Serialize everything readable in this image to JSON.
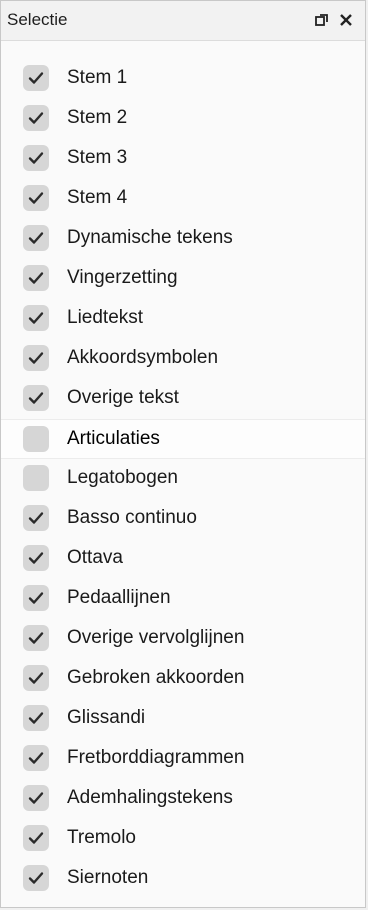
{
  "panel": {
    "title": "Selectie",
    "float_icon": "float-restore-icon",
    "close_icon": "close-icon"
  },
  "items": [
    {
      "label": "Stem 1",
      "checked": true
    },
    {
      "label": "Stem 2",
      "checked": true
    },
    {
      "label": "Stem 3",
      "checked": true
    },
    {
      "label": "Stem 4",
      "checked": true
    },
    {
      "label": "Dynamische tekens",
      "checked": true
    },
    {
      "label": "Vingerzetting",
      "checked": true
    },
    {
      "label": "Liedtekst",
      "checked": true
    },
    {
      "label": "Akkoordsymbolen",
      "checked": true
    },
    {
      "label": "Overige tekst",
      "checked": true
    },
    {
      "label": "Articulaties",
      "checked": false,
      "highlighted": true
    },
    {
      "label": "Legatobogen",
      "checked": false
    },
    {
      "label": "Basso continuo",
      "checked": true
    },
    {
      "label": "Ottava",
      "checked": true
    },
    {
      "label": "Pedaallijnen",
      "checked": true
    },
    {
      "label": "Overige vervolglijnen",
      "checked": true
    },
    {
      "label": "Gebroken akkoorden",
      "checked": true
    },
    {
      "label": "Glissandi",
      "checked": true
    },
    {
      "label": "Fretborddiagrammen",
      "checked": true
    },
    {
      "label": "Ademhalingstekens",
      "checked": true
    },
    {
      "label": "Tremolo",
      "checked": true
    },
    {
      "label": "Siernoten",
      "checked": true
    }
  ],
  "colors": {
    "checkbox_bg": "#d6d6d6",
    "checkmark": "#2b2b2b",
    "panel_bg": "#fafafa"
  }
}
